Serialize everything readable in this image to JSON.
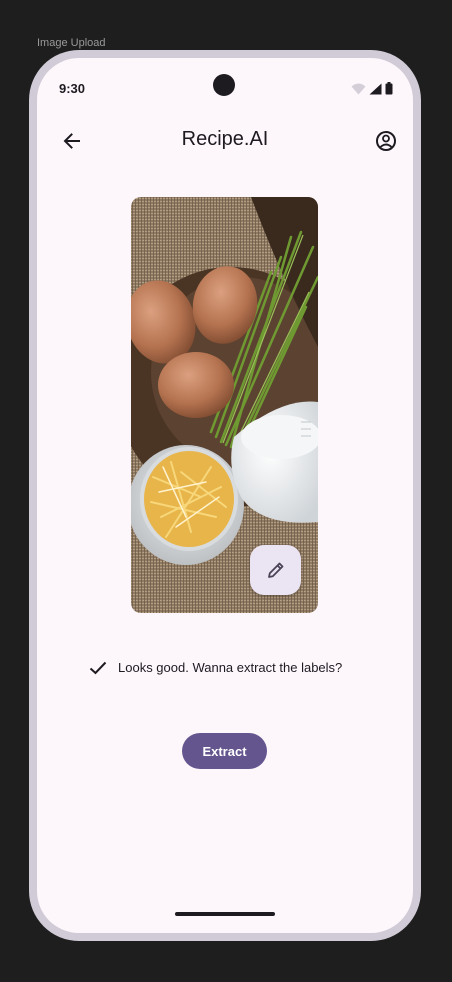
{
  "frame": {
    "label": "Image Upload"
  },
  "status_bar": {
    "time": "9:30",
    "icons": [
      "wifi-icon",
      "signal-icon",
      "battery-icon"
    ]
  },
  "top_bar": {
    "title": "Recipe.AI",
    "leading_icon": "arrow-back-icon",
    "trailing_icon": "account-circle-icon"
  },
  "preview": {
    "image": "photo of brown eggs, chives, shredded cheese and a pitcher of milk on burlap",
    "edit_icon": "pencil-icon"
  },
  "confirmation": {
    "icon": "check-icon",
    "text": "Looks good. Wanna extract the labels?"
  },
  "actions": {
    "extract_label": "Extract"
  },
  "colors": {
    "screen_background": "#fdf7fc",
    "primary": "#65558f",
    "fab_container": "#ebe4f2",
    "on_surface": "#1d1b20"
  }
}
